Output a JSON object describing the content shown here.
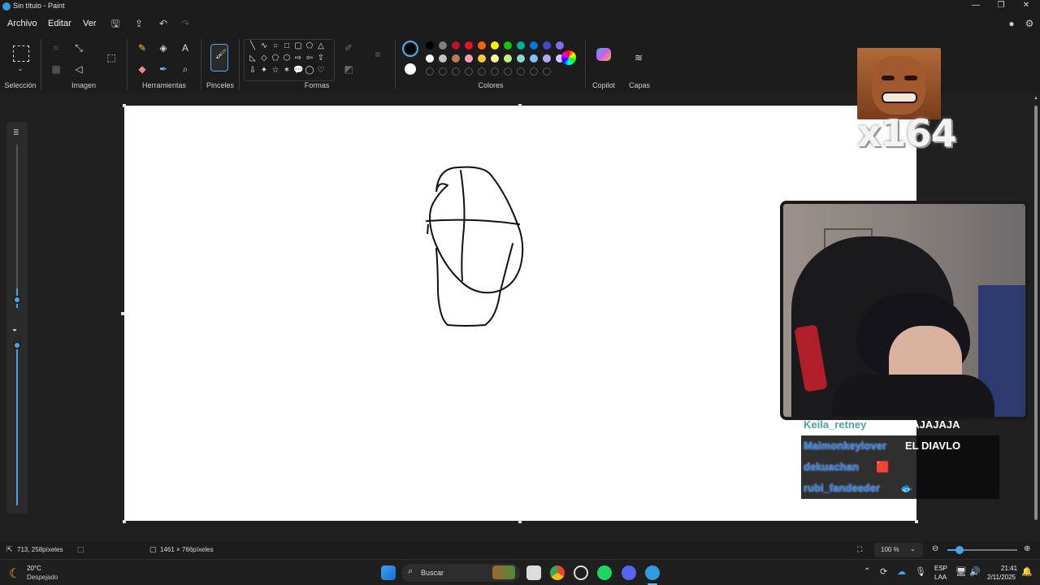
{
  "window": {
    "title": "Sin título - Paint"
  },
  "menu": {
    "file": "Archivo",
    "edit": "Editar",
    "view": "Ver"
  },
  "ribbon": {
    "groups": {
      "selection": "Selección",
      "image": "Imagen",
      "tools": "Herramientas",
      "brushes": "Pinceles",
      "shapes": "Formas",
      "colors": "Colores",
      "copilot": "Copilot",
      "layers": "Capas"
    },
    "palette_row1": [
      "#000000",
      "#7f7f7f",
      "#c0102a",
      "#e81224",
      "#f7630c",
      "#fff100",
      "#16c60c",
      "#00b294",
      "#0078d7",
      "#4b47c9",
      "#886ce4"
    ],
    "palette_row2": [
      "#ffffff",
      "#c3c3c3",
      "#b97a57",
      "#ff9eb5",
      "#ffc83d",
      "#fff59d",
      "#c5f27a",
      "#8ad8d0",
      "#7fbfff",
      "#b4a7f5",
      "#d4c7ff"
    ],
    "primary_color": "#000000",
    "secondary_color": "#ffffff"
  },
  "status": {
    "cursor_position": "713, 258píxeles",
    "canvas_size": "1461 × 766píxeles",
    "zoom": "100 %"
  },
  "overlay": {
    "combo_count": "x164",
    "chat": [
      {
        "user": "Keila_retney",
        "message": "que AJAJAJA"
      },
      {
        "user": "Maimonkeylover",
        "message": "EL DIAVLO"
      },
      {
        "user": "dekuachan",
        "message": "🟥"
      },
      {
        "user": "rubi_fandeeder",
        "message": "🐟"
      }
    ]
  },
  "taskbar": {
    "weather_temp": "20°C",
    "weather_desc": "Despejado",
    "search_label": "Buscar",
    "language": "ESP",
    "keyboard": "LAA",
    "time": "21:41",
    "date": "2/11/2025"
  }
}
